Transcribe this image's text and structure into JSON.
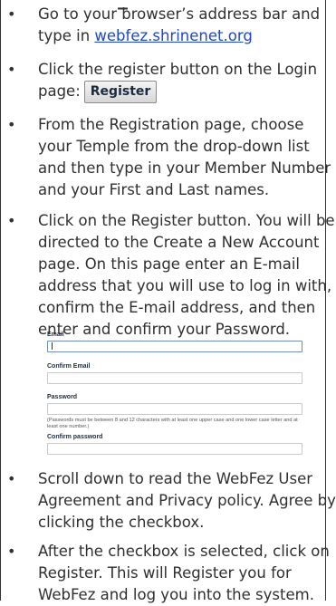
{
  "steps": [
    {
      "text_before": "Go to your browser’s address bar and type in ",
      "link": "webfez.shrinenet.org"
    },
    {
      "text_before": "Click the register button on the Login page: ",
      "button": "Register"
    },
    {
      "text": "From the Registration page, choose your Temple from the drop-down list and then type in your Member Number and your First and Last names."
    },
    {
      "text": "Click on the Register button. You will be directed to the Create a New Account page. On this page enter an E-mail address that you will use to log in with, confirm the E-mail address, and then enter and confirm your Password."
    },
    {
      "text": "Scroll down to read the WebFez User Agreement and Privacy policy. Agree by clicking the checkbox."
    },
    {
      "text": "After the checkbox is selected, click on Register. This will Register you for WebFez and log you into the system."
    }
  ],
  "form": {
    "email_label": "Email",
    "confirm_email_label": "Confirm Email",
    "password_label": "Password",
    "password_note": "(Passwords must be between 8 and 12 characters with at least one upper case and one lower case letter and at least one number.)",
    "confirm_password_label": "Confirm password"
  }
}
